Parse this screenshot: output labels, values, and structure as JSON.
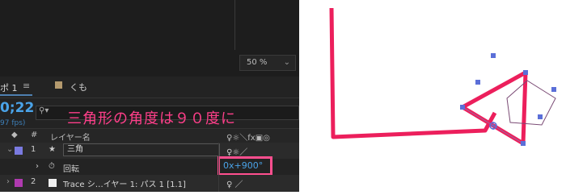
{
  "viewer": {
    "zoom_label": "50 %",
    "zoom_chevron": "⌄"
  },
  "timeline": {
    "tab_label": "ポ 1",
    "menu_glyph": "≡",
    "second_tab_label": "くも",
    "second_tab_color": "#b49a6e",
    "timecode": "0;22",
    "fps_label": "97 fps)",
    "search_glyph": "⚲▾"
  },
  "annotation": "三角形の角度は９０度に",
  "columns": {
    "hash": "#",
    "layer_name": "レイヤー名",
    "switches": "♀☼＼fx▣◎"
  },
  "layers": [
    {
      "num": "1",
      "star": "★",
      "name": "三角",
      "color": "#7a7ae0",
      "switches": "♀☼／"
    },
    {
      "stopwatch": "⏱",
      "prop_name": "回転",
      "value": "0x+900°"
    },
    {
      "num": "2",
      "name": "Trace シ…イヤー 1: パス 1 [1.1]",
      "color": "#b03ab0",
      "switches": "♀ ／"
    }
  ]
}
